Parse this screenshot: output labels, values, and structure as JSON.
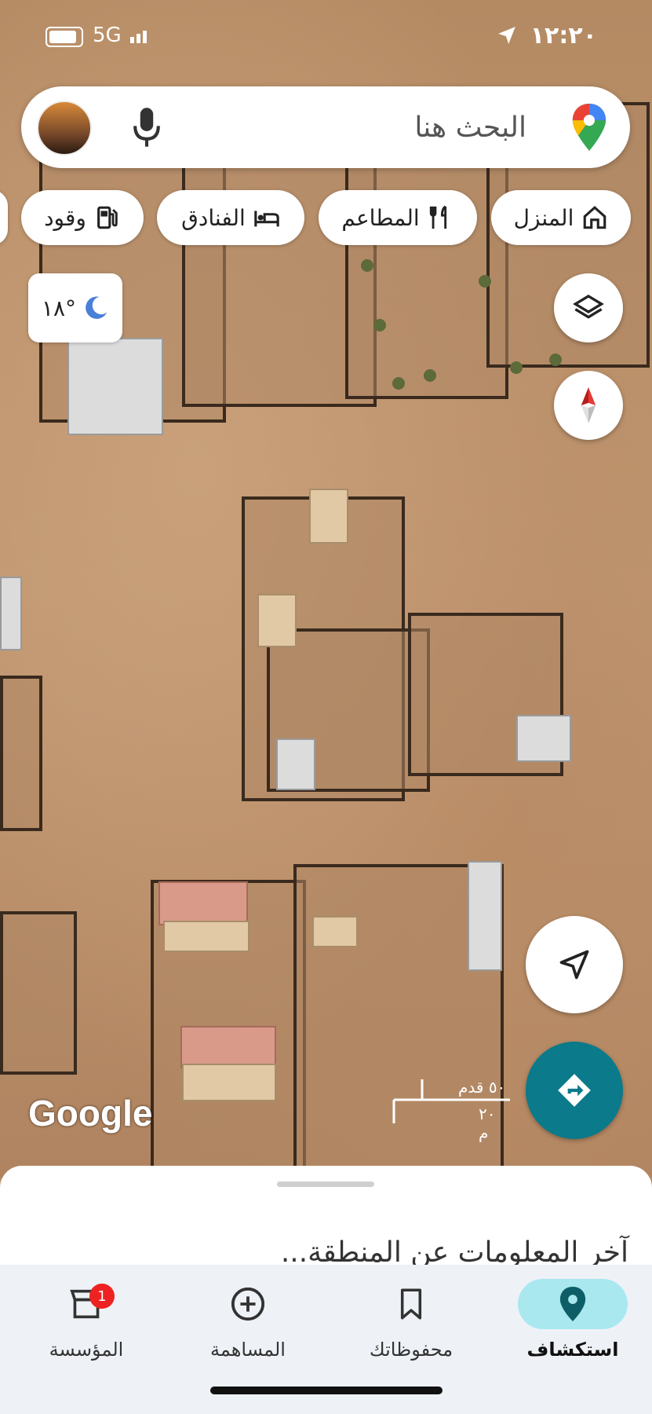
{
  "status_bar": {
    "time": "١٢:٢٠",
    "network": "5G"
  },
  "search": {
    "placeholder": "البحث هنا"
  },
  "chips": [
    {
      "label": "المنزل",
      "icon": "home-icon"
    },
    {
      "label": "المطاعم",
      "icon": "restaurant-icon"
    },
    {
      "label": "الفنادق",
      "icon": "hotel-icon"
    },
    {
      "label": "وقود",
      "icon": "gas-station-icon"
    }
  ],
  "weather": {
    "temp": "١٨°",
    "icon": "moon-icon"
  },
  "map": {
    "attribution": "Google",
    "scale_feet": "٥٠ قدم",
    "scale_meters": "٢٠ م"
  },
  "sheet": {
    "title": "آخر المعلومات عن المنطقة..."
  },
  "nav": {
    "items": [
      {
        "label": "استكشاف",
        "icon": "location-pin-icon",
        "active": true
      },
      {
        "label": "محفوظاتك",
        "icon": "bookmark-icon",
        "active": false
      },
      {
        "label": "المساهمة",
        "icon": "add-circle-icon",
        "active": false
      },
      {
        "label": "المؤسسة",
        "icon": "store-icon",
        "active": false,
        "badge": "1"
      }
    ]
  },
  "colors": {
    "accent": "#0b7a8a",
    "active_pill": "#a9e8ee",
    "badge": "#e22222"
  }
}
